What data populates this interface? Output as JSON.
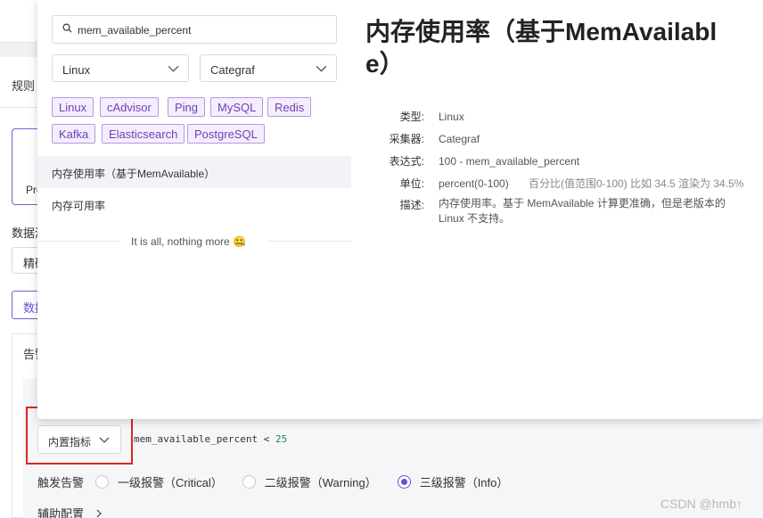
{
  "background": {
    "tab_label": "规则",
    "box_text": "Pro",
    "datasource_label": "数据源",
    "precision_select": "精确",
    "data_button": "数据",
    "panel_title": "告警"
  },
  "query": {
    "builtin_select": "内置指标",
    "expression_metric": "mem_available_percent",
    "expression_op": " < ",
    "expression_value": "25"
  },
  "severity": {
    "label": "触发告警",
    "options": [
      {
        "label": "一级报警（Critical）",
        "selected": false
      },
      {
        "label": "二级报警（Warning）",
        "selected": false
      },
      {
        "label": "三级报警（Info）",
        "selected": true
      }
    ]
  },
  "aux_config": "辅助配置",
  "watermark": "CSDN @hmb↑",
  "popup": {
    "search_value": "mem_available_percent",
    "filter_type": "Linux",
    "filter_collector": "Categraf",
    "tags": [
      "Linux",
      "cAdvisor",
      "Ping",
      "MySQL",
      "Redis",
      "Kafka",
      "Elasticsearch",
      "PostgreSQL"
    ],
    "results": [
      "内存使用率（基于MemAvailable）",
      "内存可用率"
    ],
    "end_text": "It is all, nothing more 🤐",
    "detail": {
      "title": "内存使用率（基于MemAvailable）",
      "type_label": "类型:",
      "type_value": "Linux",
      "collector_label": "采集器:",
      "collector_value": "Categraf",
      "expr_label": "表达式:",
      "expr_value": "100 - mem_available_percent",
      "unit_label": "单位:",
      "unit_value": "percent(0-100)",
      "unit_note": "百分比(值范围0-100) 比如 34.5 渲染为 34.5%",
      "desc_label": "描述:",
      "desc_value": "内存使用率。基于 MemAvailable 计算更准确，但是老版本的 Linux 不支持。"
    }
  },
  "colors": {
    "accent": "#6e4fd1",
    "tag_border": "#b597e7",
    "tag_bg": "#f4eefc",
    "highlight": "#e0251f"
  }
}
